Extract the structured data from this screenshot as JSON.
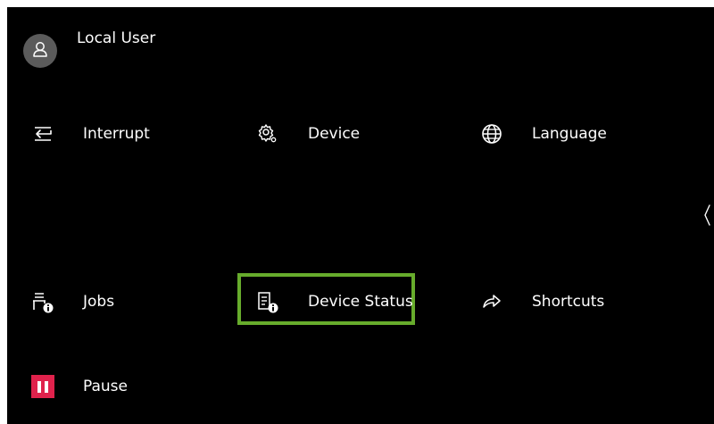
{
  "user": {
    "name": "Local User",
    "icon": "user-icon"
  },
  "tiles": {
    "interrupt": {
      "label": "Interrupt",
      "icon": "interrupt-icon"
    },
    "device": {
      "label": "Device",
      "icon": "gear-icon"
    },
    "language": {
      "label": "Language",
      "icon": "globe-icon"
    },
    "jobs": {
      "label": "Jobs",
      "icon": "jobs-info-icon"
    },
    "device_status": {
      "label": "Device Status",
      "icon": "device-status-icon",
      "selected": true
    },
    "shortcuts": {
      "label": "Shortcuts",
      "icon": "share-arrow-icon"
    },
    "pause": {
      "label": "Pause",
      "icon": "pause-icon"
    }
  },
  "colors": {
    "background": "#000000",
    "text": "#ffffff",
    "selection_border": "#67ac2c",
    "pause_accent": "#e0224c",
    "avatar_bg": "#5b5b5b"
  },
  "collapse_control": {
    "icon": "chevron-left-icon"
  }
}
